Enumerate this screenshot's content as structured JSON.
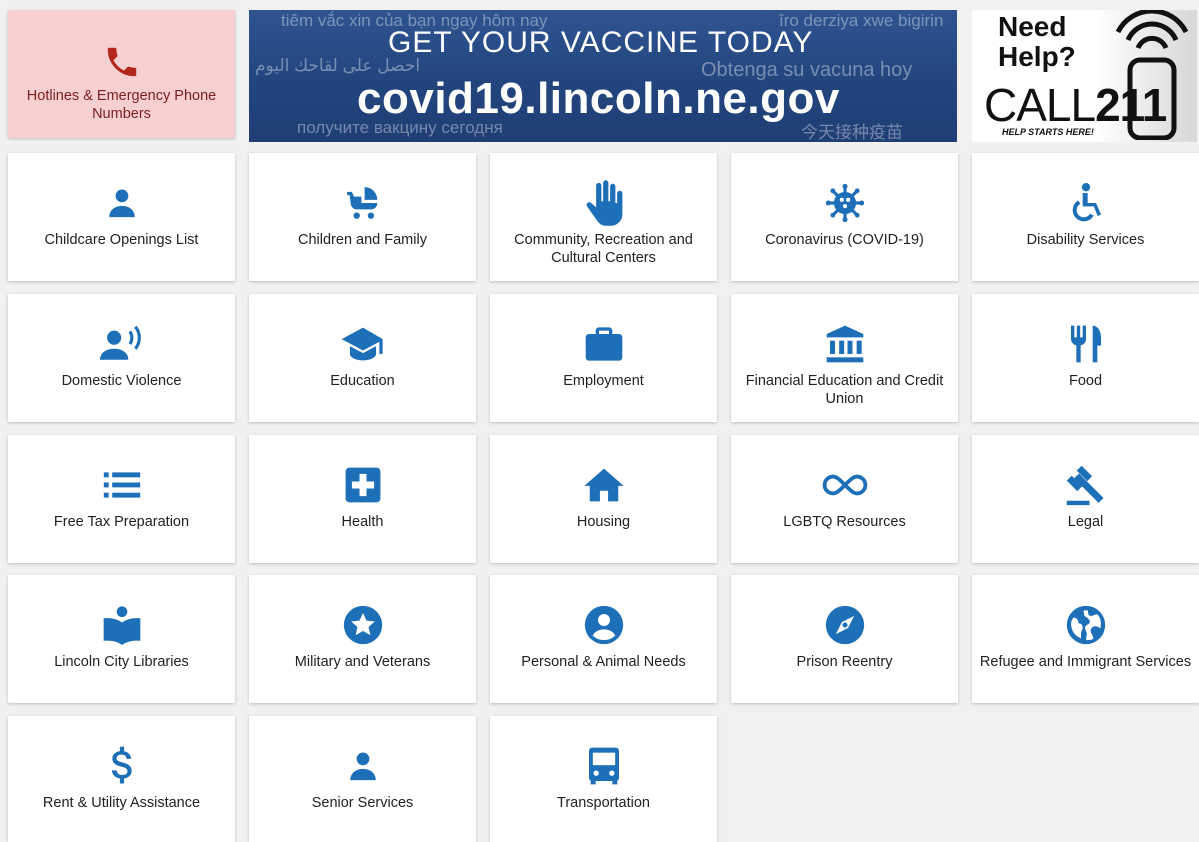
{
  "colors": {
    "icon": "#1d6fb8",
    "hotline_bg": "#f6cfd0",
    "hotline_icon": "#b3261e",
    "banner_bg": "#23457e"
  },
  "hotline": {
    "label": "Hotlines & Emergency Phone Numbers",
    "icon": "phone-icon"
  },
  "vaccine_banner": {
    "headline": "GET YOUR VACCINE TODAY",
    "url": "covid19.lincoln.ne.gov",
    "translations": [
      "tiêm vắc xin của bạn ngay hôm nay",
      "îro derziya xwe bigirin",
      "احصل على لقاحك اليوم",
      "Obtenga su vacuna hoy",
      "получите вакцину сегодня",
      "今天接种疫苗"
    ]
  },
  "call211": {
    "need": "Need",
    "help": "Help?",
    "call": "CALL",
    "number": "211",
    "tagline": "HELP STARTS HERE!"
  },
  "tiles": [
    {
      "label": "Childcare Openings List",
      "icon": "person-icon"
    },
    {
      "label": "Children and Family",
      "icon": "stroller-icon"
    },
    {
      "label": "Community, Recreation and Cultural Centers",
      "icon": "hand-icon"
    },
    {
      "label": "Coronavirus (COVID-19)",
      "icon": "virus-icon"
    },
    {
      "label": "Disability Services",
      "icon": "wheelchair-icon"
    },
    {
      "label": "Domestic Violence",
      "icon": "voice-icon"
    },
    {
      "label": "Education",
      "icon": "graduation-cap-icon"
    },
    {
      "label": "Employment",
      "icon": "briefcase-icon"
    },
    {
      "label": "Financial Education and Credit Union",
      "icon": "bank-icon"
    },
    {
      "label": "Food",
      "icon": "utensils-icon"
    },
    {
      "label": "Free Tax Preparation",
      "icon": "list-icon"
    },
    {
      "label": "Health",
      "icon": "medical-cross-icon"
    },
    {
      "label": "Housing",
      "icon": "home-icon"
    },
    {
      "label": "LGBTQ Resources",
      "icon": "infinity-icon"
    },
    {
      "label": "Legal",
      "icon": "gavel-icon"
    },
    {
      "label": "Lincoln City Libraries",
      "icon": "reader-icon"
    },
    {
      "label": "Military and Veterans",
      "icon": "star-circle-icon"
    },
    {
      "label": "Personal & Animal Needs",
      "icon": "account-circle-icon"
    },
    {
      "label": "Prison Reentry",
      "icon": "compass-icon"
    },
    {
      "label": "Refugee and Immigrant Services",
      "icon": "globe-icon"
    },
    {
      "label": "Rent & Utility Assistance",
      "icon": "dollar-icon"
    },
    {
      "label": "Senior Services",
      "icon": "person-icon"
    },
    {
      "label": "Transportation",
      "icon": "bus-icon"
    }
  ]
}
